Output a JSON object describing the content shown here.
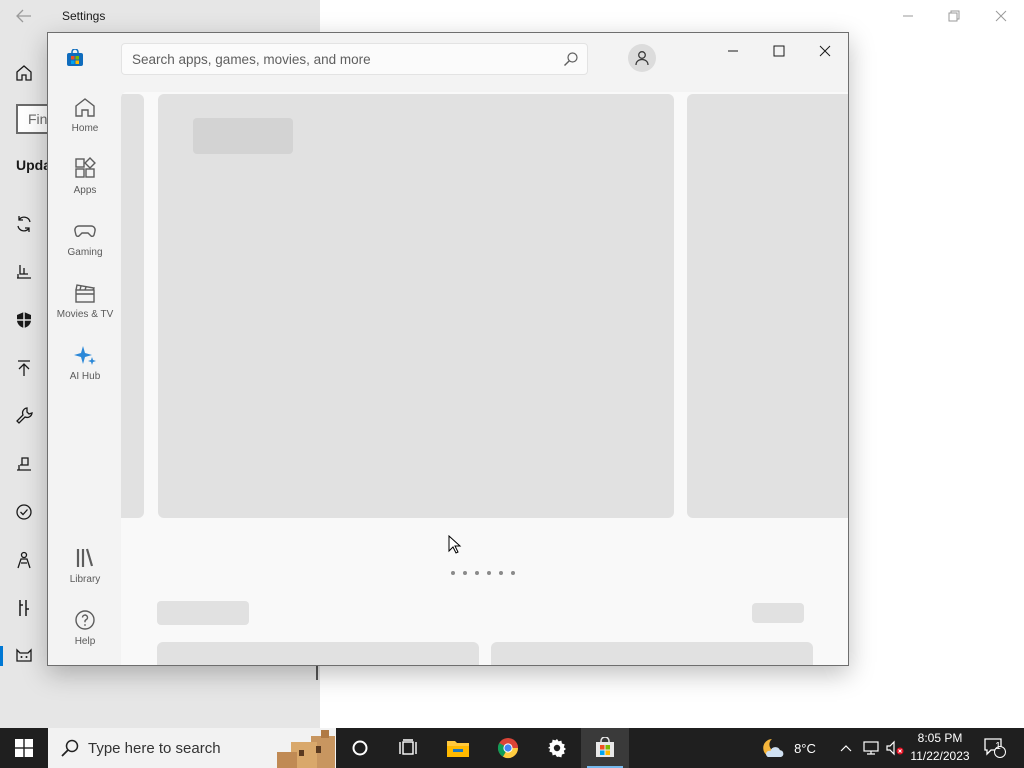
{
  "settings": {
    "title": "Settings",
    "search_text": "Fin",
    "heading": "Upda",
    "icons": [
      "home-icon",
      "sync-icon",
      "delivery-icon",
      "shield-icon",
      "upload-icon",
      "wrench-icon",
      "user-recovery-icon",
      "check-circle-icon",
      "person-icon",
      "tools-icon",
      "cat-icon"
    ]
  },
  "store": {
    "search_placeholder": "Search apps, games, movies, and more",
    "nav": [
      {
        "label": "Home",
        "icon": "home-icon"
      },
      {
        "label": "Apps",
        "icon": "apps-icon"
      },
      {
        "label": "Gaming",
        "icon": "gamepad-icon"
      },
      {
        "label": "Movies & TV",
        "icon": "clapper-icon"
      },
      {
        "label": "AI Hub",
        "icon": "sparkle-icon"
      }
    ],
    "nav_bottom": [
      {
        "label": "Library",
        "icon": "library-icon"
      },
      {
        "label": "Help",
        "icon": "help-icon"
      }
    ],
    "hero_page_count": 6,
    "accent_color": "#0078d4",
    "ai_hub_color": "#2b88d8"
  },
  "taskbar": {
    "search_placeholder": "Type here to search",
    "weather_temp": "8°C",
    "time": "8:05 PM",
    "date": "11/22/2023",
    "notification_count": "1",
    "apps": [
      "cortana-icon",
      "task-view-icon",
      "file-explorer-icon",
      "chrome-icon",
      "settings-gear-icon",
      "store-icon"
    ]
  }
}
